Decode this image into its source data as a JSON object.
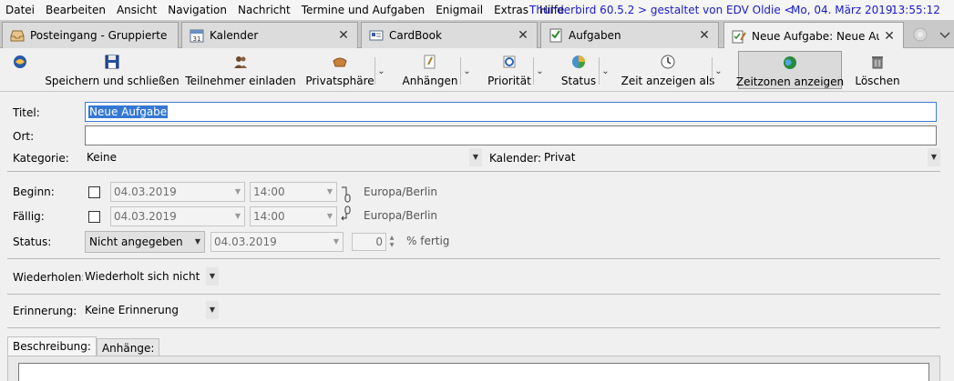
{
  "menubar": {
    "items": [
      "Datei",
      "Bearbeiten",
      "Ansicht",
      "Navigation",
      "Nachricht",
      "Termine und Aufgaben",
      "Enigmail",
      "Extras",
      "Hilfe"
    ],
    "app_version": "Thunderbird 60.5.2",
    "designed_by": "> gestaltet von EDV Oldie <",
    "date": "Mo, 04. März 2019",
    "time": "13:55:12",
    "info_color": "#1a1ac8"
  },
  "tabs": [
    {
      "label": "Posteingang - Gruppierte Ord",
      "icon": "inbox-icon",
      "closable": false
    },
    {
      "label": "Kalender",
      "icon": "calendar-icon",
      "closable": true
    },
    {
      "label": "CardBook",
      "icon": "address-book-icon",
      "closable": true
    },
    {
      "label": "Aufgaben",
      "icon": "tasks-icon",
      "closable": true
    },
    {
      "label": "Neue Aufgabe: Neue Aufga",
      "icon": "edit-task-icon",
      "closable": true,
      "active": true
    }
  ],
  "toolbar": {
    "save_close": "Speichern und schließen",
    "invite": "Teilnehmer einladen",
    "privacy": "Privatsphäre",
    "attachments": "Anhängen",
    "priority": "Priorität",
    "status": "Status",
    "show_time_as": "Zeit anzeigen als",
    "show_timezones": "Zeitzonen anzeigen",
    "delete": "Löschen"
  },
  "form": {
    "title_label": "Titel:",
    "title_value": "Neue Aufgabe",
    "location_label": "Ort:",
    "location_value": "",
    "category_label": "Kategorie:",
    "category_value": "Keine",
    "calendar_label": "Kalender:",
    "calendar_value": "Privat",
    "start_label": "Beginn:",
    "start_date": "04.03.2019",
    "start_time": "14:00",
    "start_tz": "Europa/Berlin",
    "due_label": "Fällig:",
    "due_date": "04.03.2019",
    "due_time": "14:00",
    "due_tz": "Europa/Berlin",
    "status_label": "Status:",
    "status_value": "Nicht angegeben",
    "status_date": "04.03.2019",
    "percent_value": "0",
    "percent_label": "% fertig",
    "repeat_label": "Wiederholen:",
    "repeat_value": "Wiederholt sich nicht",
    "reminder_label": "Erinnerung:",
    "reminder_value": "Keine Erinnerung",
    "desc_tab": "Beschreibung:",
    "attach_tab": "Anhänge:"
  }
}
